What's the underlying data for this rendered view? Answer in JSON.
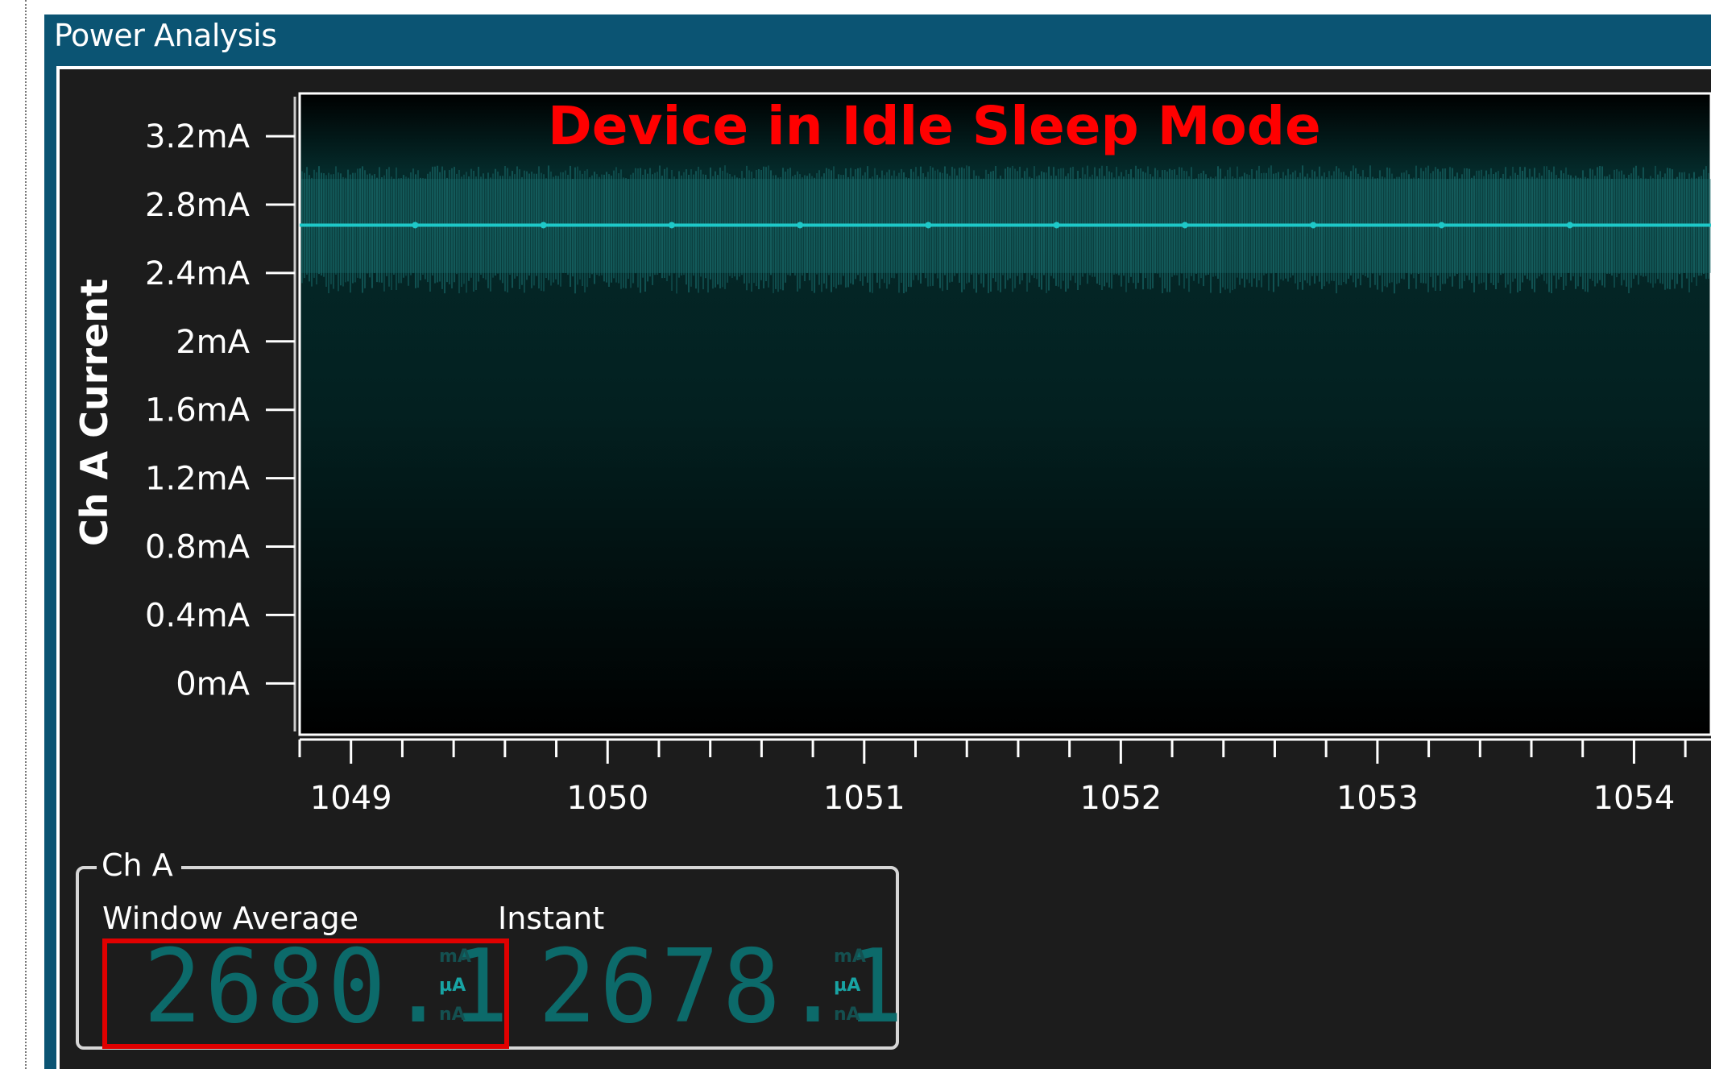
{
  "window": {
    "title": "Power Analysis"
  },
  "annotation": {
    "text": "Device in Idle Sleep Mode",
    "color": "#ff0000"
  },
  "chart_data": {
    "type": "line",
    "title": "",
    "xlabel": "",
    "ylabel": "Ch A Current",
    "y_unit": "mA",
    "ylim": [
      -0.3,
      3.45
    ],
    "xlim": [
      1048.8,
      1054.3
    ],
    "y_ticks": [
      0,
      0.4,
      0.8,
      1.2,
      1.6,
      2,
      2.4,
      2.8,
      3.2
    ],
    "y_tick_labels": [
      "0mA",
      "0.4mA",
      "0.8mA",
      "1.2mA",
      "1.6mA",
      "2mA",
      "2.4mA",
      "2.8mA",
      "3.2mA"
    ],
    "x_ticks": [
      1049,
      1050,
      1051,
      1052,
      1053,
      1054
    ],
    "x_tick_labels": [
      "1049",
      "1050",
      "1051",
      "1052",
      "1053",
      "1054"
    ],
    "x_minor_step": 0.2,
    "series": [
      {
        "values_description": "",
        "x": [
          1048.8,
          1049.25,
          1049.75,
          1050.25,
          1050.75,
          1051.25,
          1051.75,
          1052.25,
          1052.75,
          1053.25,
          1053.75,
          1054.3
        ],
        "y": [
          2.68,
          2.68,
          2.68,
          2.68,
          2.68,
          2.68,
          2.68,
          2.68,
          2.68,
          2.68,
          2.68,
          2.68
        ],
        "noise_band": [
          2.4,
          2.95
        ]
      }
    ],
    "colors": {
      "line": "#1ec8c8",
      "noise": "#1a6e6e",
      "plot_top": "#002222",
      "plot_bottom": "#000000"
    },
    "grid": false,
    "legend": "none"
  },
  "meters": {
    "channel_label": "Ch A",
    "window_average": {
      "label": "Window Average",
      "value": "2680.1",
      "units": [
        "mA",
        "µA",
        "nA"
      ],
      "active_unit": "µA"
    },
    "instant": {
      "label": "Instant",
      "value": "2678.1",
      "units": [
        "mA",
        "µA",
        "nA"
      ],
      "active_unit": "µA"
    }
  }
}
